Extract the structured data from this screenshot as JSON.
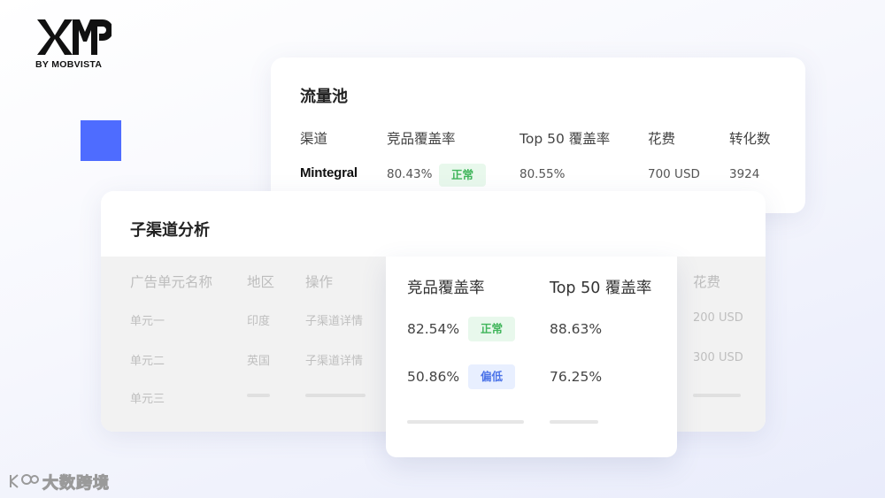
{
  "logo": {
    "mark": "XMP",
    "subtitle": "BY MOBVISTA"
  },
  "pool": {
    "title": "流量池",
    "headers": [
      "渠道",
      "竞品覆盖率",
      "Top 50 覆盖率",
      "花费",
      "转化数"
    ],
    "row": {
      "channel": "Mintegral",
      "coverage": "80.43%",
      "status": "正常",
      "top50": "80.55%",
      "cost": "700 USD",
      "conversions": "3924"
    }
  },
  "sub": {
    "title": "子渠道分析",
    "headers": [
      "广告单元名称",
      "地区",
      "操作",
      "花费"
    ],
    "rows": [
      {
        "name": "单元一",
        "region": "印度",
        "action": "子渠道详情",
        "cost": "200 USD"
      },
      {
        "name": "单元二",
        "region": "英国",
        "action": "子渠道详情",
        "cost": "300 USD"
      },
      {
        "name": "单元三"
      }
    ]
  },
  "popup": {
    "headers": [
      "竞品覆盖率",
      "Top 50 覆盖率"
    ],
    "rows": [
      {
        "coverage": "82.54%",
        "status": "正常",
        "top50": "88.63%"
      },
      {
        "coverage": "50.86%",
        "status": "偏低",
        "top50": "76.25%"
      }
    ]
  },
  "watermark": {
    "text": "大数跨境"
  },
  "colors": {
    "accent": "#4e6cff",
    "status_normal": "#3fb55a",
    "status_low": "#4b73e8"
  }
}
